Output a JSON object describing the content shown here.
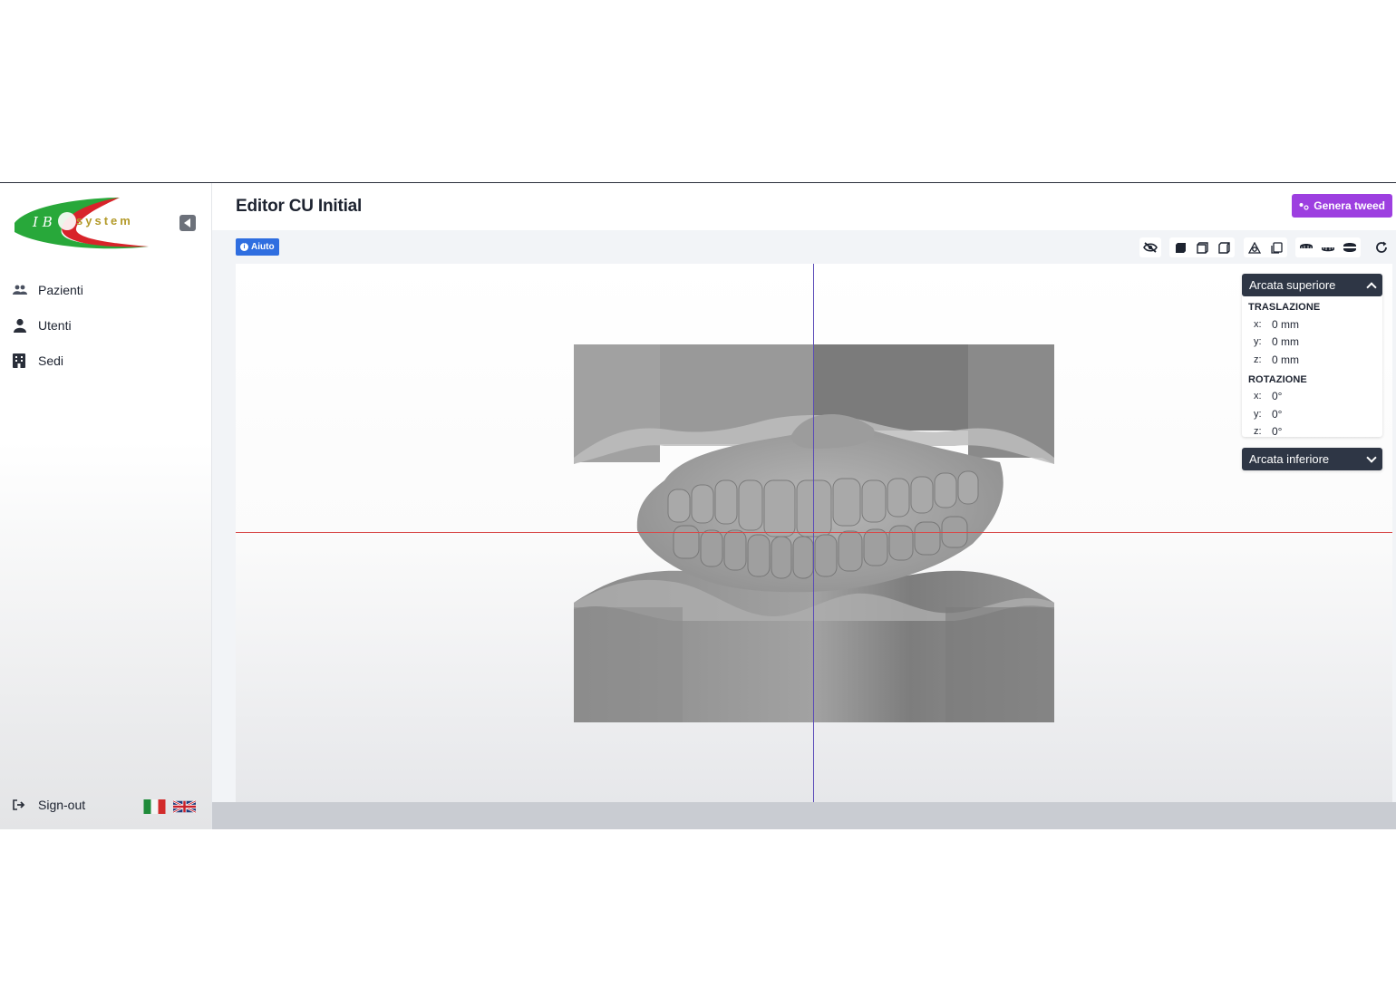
{
  "brand": {
    "logo_letters": "I B",
    "logo_word": "system"
  },
  "sidebar": {
    "items": [
      {
        "label": "Pazienti",
        "icon": "users-icon"
      },
      {
        "label": "Utenti",
        "icon": "user-icon"
      },
      {
        "label": "Sedi",
        "icon": "building-icon"
      }
    ],
    "signout_label": "Sign-out",
    "languages": [
      "it-flag",
      "uk-flag"
    ]
  },
  "header": {
    "title": "Editor CU Initial",
    "genera_label": "Genera tweed"
  },
  "toolbar": {
    "aiuto_label": "Aiuto",
    "tools": [
      "hide-icon",
      "view-solid-icon",
      "view-front-icon",
      "view-side-icon",
      "occlusion-icon",
      "copy-icon",
      "upper-arch-icon",
      "lower-arch-icon",
      "both-arches-icon",
      "reset-icon"
    ]
  },
  "panels": {
    "upper": {
      "title": "Arcata superiore",
      "translation_title": "TRASLAZIONE",
      "translation": [
        {
          "axis": "x:",
          "value": "0 mm"
        },
        {
          "axis": "y:",
          "value": "0 mm"
        },
        {
          "axis": "z:",
          "value": "0 mm"
        }
      ],
      "rotation_title": "ROTAZIONE",
      "rotation": [
        {
          "axis": "x:",
          "value": "0°"
        },
        {
          "axis": "y:",
          "value": "0°"
        },
        {
          "axis": "z:",
          "value": "0°"
        }
      ]
    },
    "lower": {
      "title": "Arcata inferiore"
    }
  },
  "colors": {
    "accent": "#9d3fe0",
    "help": "#2f6ee0",
    "panel_head": "#2e3645",
    "axis_x": "#d84a4a",
    "axis_y": "#5a4bb8"
  }
}
